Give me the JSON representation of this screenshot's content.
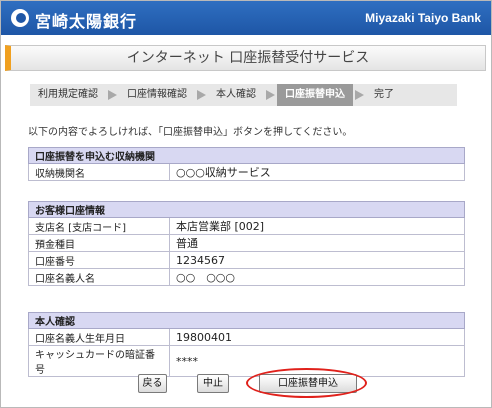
{
  "header": {
    "bank_name_jp": "宮崎太陽銀行",
    "bank_name_en": "Miyazaki Taiyo Bank",
    "brand_color": "#1e56a6"
  },
  "page": {
    "title": "インターネット 口座振替受付サービス"
  },
  "steps": {
    "items": [
      "利用規定確認",
      "口座情報確認",
      "本人確認",
      "口座振替申込",
      "完了"
    ],
    "active_index": 3
  },
  "instruction": "以下の内容でよろしければ、「口座振替申込」ボタンを押してください。",
  "section_institution": {
    "heading": "口座振替を申込む収納機関",
    "rows": [
      {
        "label": "収納機関名",
        "value": "○○○収納サービス"
      }
    ]
  },
  "section_account": {
    "heading": "お客様口座情報",
    "rows": [
      {
        "label": "支店名 [支店コード]",
        "value": "本店営業部 [002]"
      },
      {
        "label": "預金種目",
        "value": "普通"
      },
      {
        "label": "口座番号",
        "value": "1234567"
      },
      {
        "label": "口座名義人名",
        "value": "○○　○○○"
      }
    ]
  },
  "section_identity": {
    "heading": "本人確認",
    "rows": [
      {
        "label": "口座名義人生年月日",
        "value": "19800401"
      },
      {
        "label": "キャッシュカードの暗証番号",
        "value": "****"
      }
    ]
  },
  "buttons": {
    "back": "戻る",
    "stop": "中止",
    "apply": "口座振替申込"
  },
  "highlight_color": "#e0211b"
}
